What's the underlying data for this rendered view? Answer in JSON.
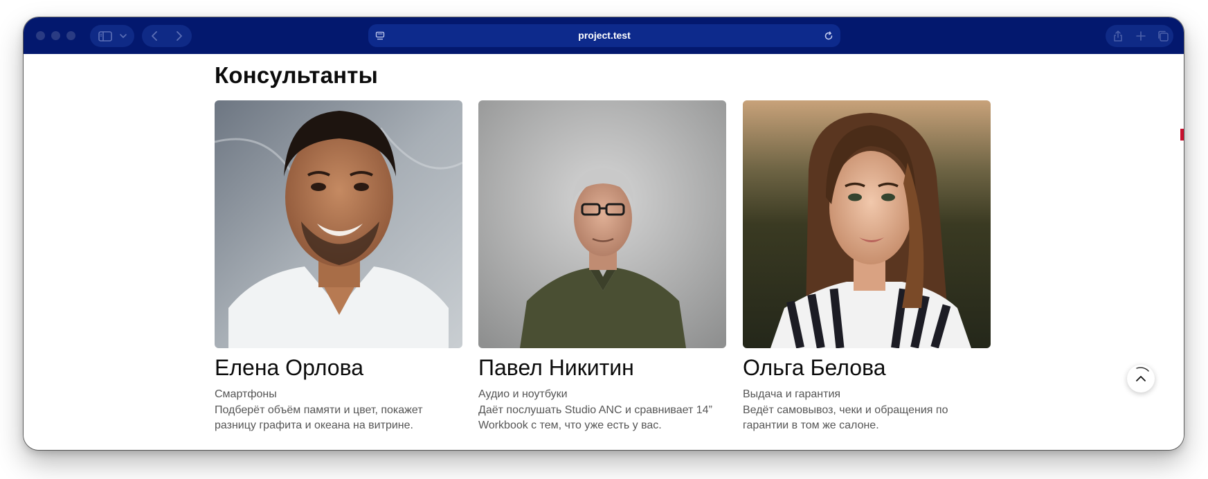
{
  "browser": {
    "url": "project.test"
  },
  "page": {
    "title": "Консультанты"
  },
  "consultants": [
    {
      "name": "Елена Орлова",
      "role": "Смартфоны",
      "description": "Подберёт объём памяти и цвет, покажет разницу графита и океана на витрине."
    },
    {
      "name": "Павел Никитин",
      "role": "Аудио и ноутбуки",
      "description": "Даёт послушать Studio ANC и сравнивает 14” Workbook с тем, что уже есть у вас."
    },
    {
      "name": "Ольга Белова",
      "role": "Выдача и гарантия",
      "description": "Ведёт самовывоз, чеки и обращения по гарантии в том же салоне."
    }
  ],
  "colors": {
    "toolbar": "#03186e",
    "address_bar": "#0d2a8c",
    "accent_marker": "#c8102e",
    "text_primary": "#0b0b0b",
    "text_secondary": "#555555"
  },
  "icons": {
    "sidebar": "sidebar-icon",
    "chevron": "chevron-down-icon",
    "back": "chevron-left-icon",
    "forward": "chevron-right-icon",
    "site": "site-settings-icon",
    "reload": "reload-icon",
    "share": "share-icon",
    "new_tab": "plus-icon",
    "tabs": "tab-overview-icon",
    "scroll_top": "chevron-up-icon"
  }
}
